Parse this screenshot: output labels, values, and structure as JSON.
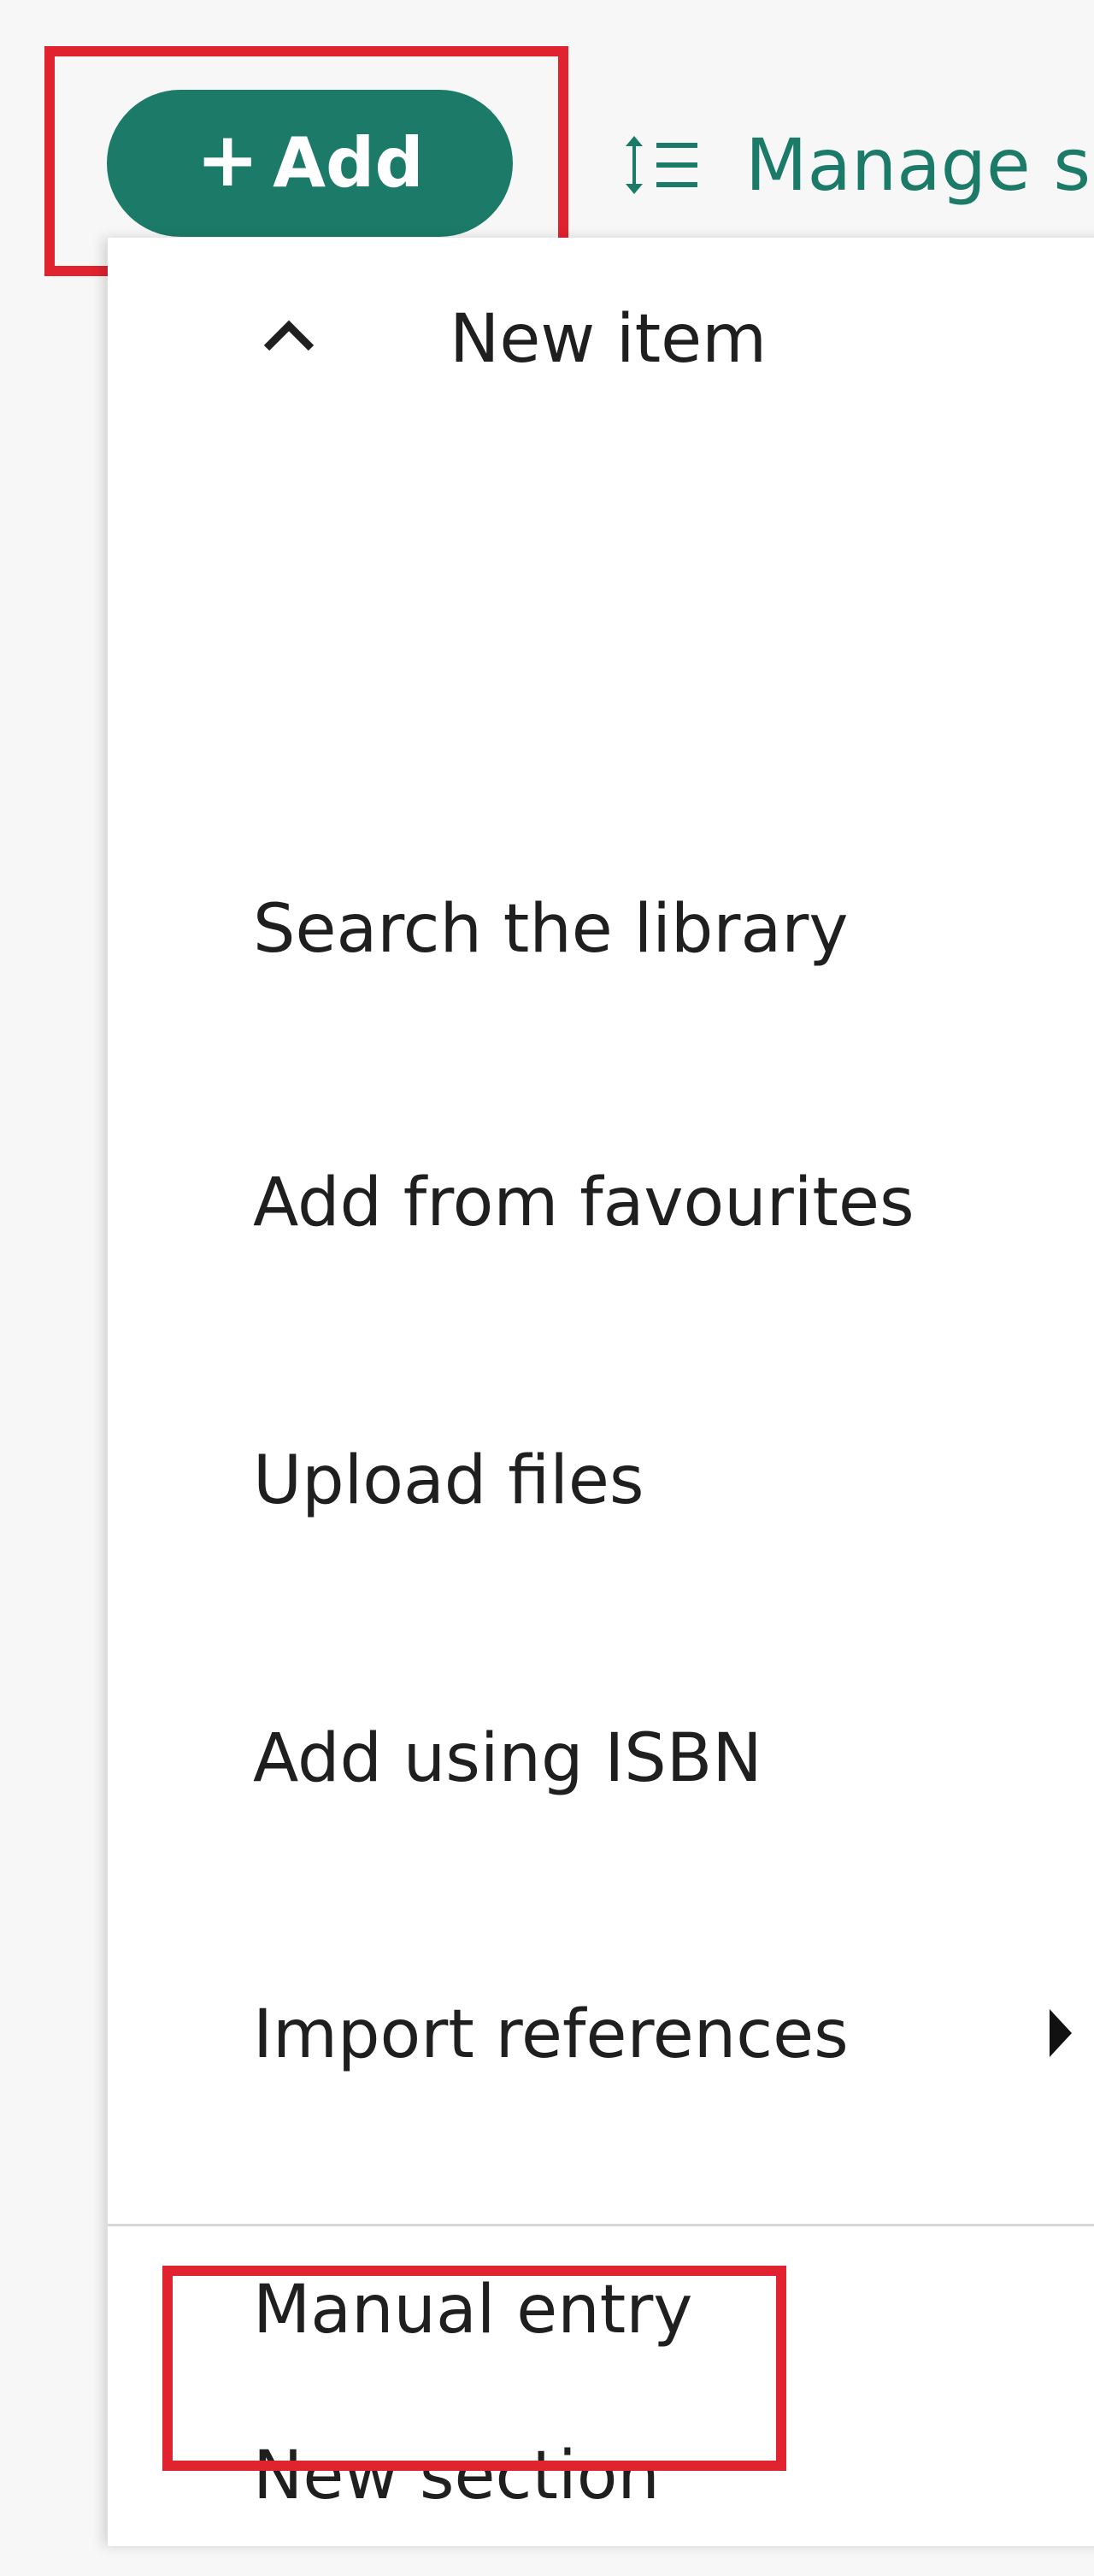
{
  "toolbar": {
    "add_button": {
      "icon": "plus-icon",
      "plus_glyph": "+",
      "label": "Add",
      "color": "#1b7b68"
    },
    "manage_button": {
      "icon": "sort-list-icon",
      "label": "Manage s"
    }
  },
  "menu": {
    "header": {
      "icon": "chevron-up-icon",
      "label": "New item"
    },
    "items": [
      {
        "label": "Search the library"
      },
      {
        "label": "Add from favourites"
      },
      {
        "label": "Upload files"
      },
      {
        "label": "Add using ISBN"
      },
      {
        "label": "Import references",
        "submenu_icon": "triangle-right-icon"
      },
      {
        "label": "Manual entry"
      }
    ],
    "section_item": {
      "label": "New section"
    }
  },
  "highlight": {
    "color": "#e0232e"
  }
}
